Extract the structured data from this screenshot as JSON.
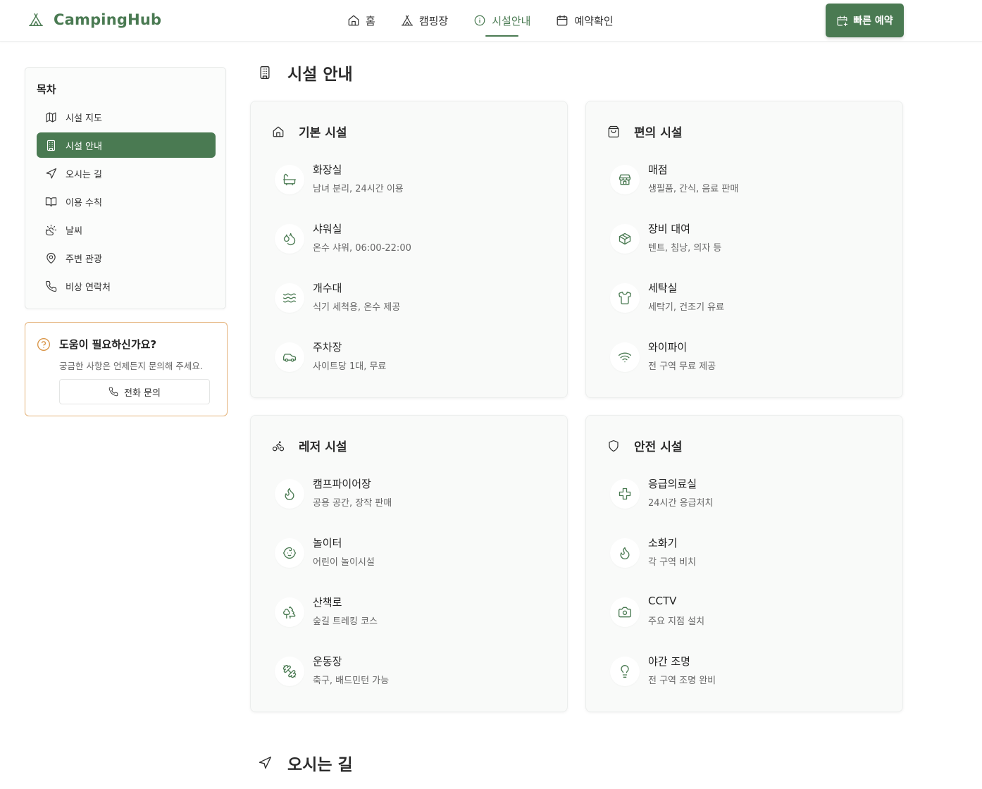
{
  "header": {
    "brand": "CampingHub",
    "nav": [
      {
        "label": "홈",
        "icon": "home-icon"
      },
      {
        "label": "캠핑장",
        "icon": "tent-icon"
      },
      {
        "label": "시설안내",
        "icon": "info-icon",
        "active": true
      },
      {
        "label": "예약확인",
        "icon": "calendar-icon"
      }
    ],
    "quick_reserve": "빠른 예약"
  },
  "sidebar": {
    "title": "목차",
    "items": [
      {
        "label": "시설 지도",
        "icon": "map-icon"
      },
      {
        "label": "시설 안내",
        "icon": "building-icon",
        "active": true
      },
      {
        "label": "오시는 길",
        "icon": "navigation-icon"
      },
      {
        "label": "이용 수칙",
        "icon": "book-icon"
      },
      {
        "label": "날씨",
        "icon": "weather-icon"
      },
      {
        "label": "주변 관광",
        "icon": "map-pin-icon"
      },
      {
        "label": "비상 연락처",
        "icon": "phone-icon"
      }
    ]
  },
  "help": {
    "title": "도움이 필요하신가요?",
    "desc": "궁금한 사항은 언제든지 문의해 주세요.",
    "button": "전화 문의"
  },
  "main": {
    "section_title": "시설 안내",
    "next_section_title": "오시는 길",
    "cards": [
      {
        "title": "기본 시설",
        "icon": "home-icon",
        "items": [
          {
            "name": "화장실",
            "desc": "남녀 분리, 24시간 이용",
            "icon": "bath-icon"
          },
          {
            "name": "샤워실",
            "desc": "온수 샤워, 06:00-22:00",
            "icon": "droplets-icon"
          },
          {
            "name": "개수대",
            "desc": "식기 세척용, 온수 제공",
            "icon": "waves-icon"
          },
          {
            "name": "주차장",
            "desc": "사이트당 1대, 무료",
            "icon": "car-icon"
          }
        ]
      },
      {
        "title": "편의 시설",
        "icon": "shopping-bag-icon",
        "items": [
          {
            "name": "매점",
            "desc": "생필품, 간식, 음료 판매",
            "icon": "store-icon"
          },
          {
            "name": "장비 대여",
            "desc": "텐트, 침낭, 의자 등",
            "icon": "package-icon"
          },
          {
            "name": "세탁실",
            "desc": "세탁기, 건조기 유료",
            "icon": "shirt-icon"
          },
          {
            "name": "와이파이",
            "desc": "전 구역 무료 제공",
            "icon": "wifi-icon"
          }
        ]
      },
      {
        "title": "레저 시설",
        "icon": "bike-icon",
        "items": [
          {
            "name": "캠프파이어장",
            "desc": "공용 공간, 장작 판매",
            "icon": "flame-icon"
          },
          {
            "name": "놀이터",
            "desc": "어린이 놀이시설",
            "icon": "baby-icon"
          },
          {
            "name": "산책로",
            "desc": "숲길 트레킹 코스",
            "icon": "trees-icon"
          },
          {
            "name": "운동장",
            "desc": "축구, 배드민턴 가능",
            "icon": "dumbbell-icon"
          }
        ]
      },
      {
        "title": "안전 시설",
        "icon": "shield-icon",
        "items": [
          {
            "name": "응급의료실",
            "desc": "24시간 응급처치",
            "icon": "medical-cross-icon"
          },
          {
            "name": "소화기",
            "desc": "각 구역 비치",
            "icon": "flame-icon"
          },
          {
            "name": "CCTV",
            "desc": "주요 지점 설치",
            "icon": "camera-icon"
          },
          {
            "name": "야간 조명",
            "desc": "전 구역 조명 완비",
            "icon": "lightbulb-icon"
          }
        ]
      }
    ]
  }
}
